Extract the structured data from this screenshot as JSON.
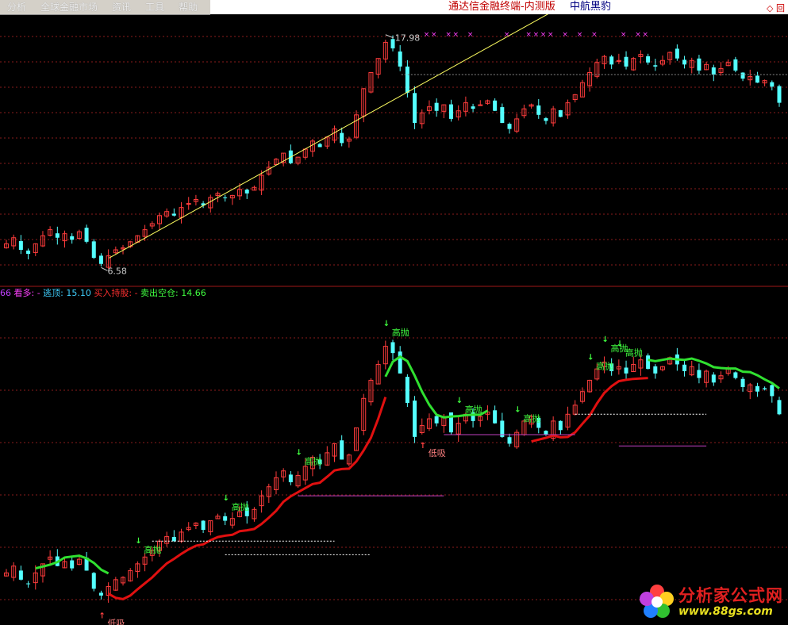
{
  "menu": {
    "items": [
      "分析",
      "全球金融市场",
      "资讯",
      "工具",
      "帮助"
    ]
  },
  "titlebar": {
    "app_title": "通达信金融终端-内测版",
    "stock_name": "中航黑豹",
    "controls": "◇ 回"
  },
  "legend": {
    "prefix": "66",
    "kanduo": "看多: -",
    "taoding": "逃顶: 15.10",
    "mairu": "买入持股: -",
    "maichu": "卖出空仓: 14.66"
  },
  "labels": {
    "gaopao": "高抛",
    "dixi": "低吸"
  },
  "watermark": {
    "name": "分析家公式网",
    "url": "www.88gs.com"
  },
  "colors": {
    "up": "#ff3c3c",
    "down": "#54ffff",
    "grid": "#8a1c1c",
    "trend": "#ffff60",
    "buy_line": "#e01010",
    "sell_line": "#30e030",
    "magenta": "#c040c0",
    "marker": "#ff40ff"
  },
  "chart_data": {
    "type": "candlestick",
    "high_marker": 17.98,
    "low_marker": 6.58,
    "high_label": "17.98",
    "low_label": "6.58",
    "closes": [
      7.6,
      7.9,
      7.3,
      7.1,
      7.6,
      8.0,
      8.3,
      7.9,
      8.1,
      7.8,
      8.2,
      7.7,
      6.9,
      6.6,
      7.0,
      7.3,
      7.4,
      7.7,
      8.0,
      8.3,
      8.6,
      9.0,
      9.2,
      9.0,
      9.4,
      9.6,
      9.8,
      9.5,
      9.9,
      10.1,
      9.9,
      10.0,
      10.3,
      10.1,
      10.4,
      11.0,
      11.4,
      11.8,
      12.1,
      11.6,
      11.9,
      12.3,
      12.7,
      12.4,
      12.9,
      13.3,
      12.6,
      12.8,
      14.0,
      15.3,
      16.1,
      16.8,
      17.6,
      17.3,
      16.4,
      15.1,
      13.6,
      14.1,
      14.4,
      14.2,
      14.5,
      13.8,
      14.2,
      14.6,
      14.3,
      14.5,
      14.7,
      14.2,
      13.6,
      13.3,
      13.8,
      14.3,
      14.5,
      14.0,
      13.7,
      14.3,
      13.9,
      14.6,
      15.0,
      15.6,
      16.1,
      16.6,
      16.9,
      16.5,
      16.7,
      16.4,
      16.8,
      17.0,
      16.6,
      16.4,
      16.7,
      17.1,
      16.8,
      16.5,
      16.7,
      16.2,
      16.5,
      16.0,
      16.3,
      16.6,
      16.2,
      15.8,
      15.9,
      15.6,
      15.7,
      15.4,
      14.6
    ],
    "trend_line": {
      "from": 6.58,
      "to": 17.4
    },
    "price_gridlines": 10
  }
}
